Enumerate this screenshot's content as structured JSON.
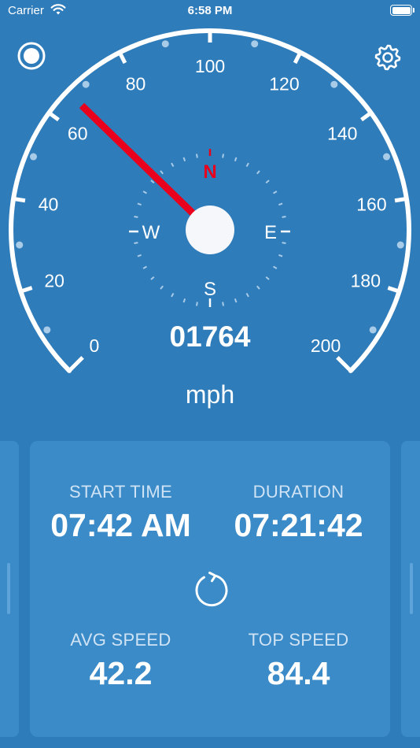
{
  "status_bar": {
    "carrier": "Carrier",
    "time": "6:58 PM"
  },
  "icons": {
    "record": "record-icon",
    "settings": "gear-icon",
    "reset": "reset-icon",
    "wifi": "wifi-icon",
    "battery": "battery-icon"
  },
  "speedometer": {
    "labels": [
      "0",
      "20",
      "40",
      "60",
      "80",
      "100",
      "120",
      "140",
      "160",
      "180",
      "200"
    ],
    "needle_value": 66,
    "max": 200,
    "odometer": "01764",
    "unit": "mph",
    "needle_color": "#e8001c"
  },
  "compass": {
    "north": "N",
    "south": "S",
    "east": "E",
    "west": "W",
    "north_color": "#e8001c"
  },
  "stats": {
    "start_time": {
      "label": "START TIME",
      "value": "07:42 AM"
    },
    "duration": {
      "label": "DURATION",
      "value": "07:21:42"
    },
    "avg_speed": {
      "label": "AVG SPEED",
      "value": "42.2"
    },
    "top_speed": {
      "label": "TOP SPEED",
      "value": "84.4"
    }
  }
}
